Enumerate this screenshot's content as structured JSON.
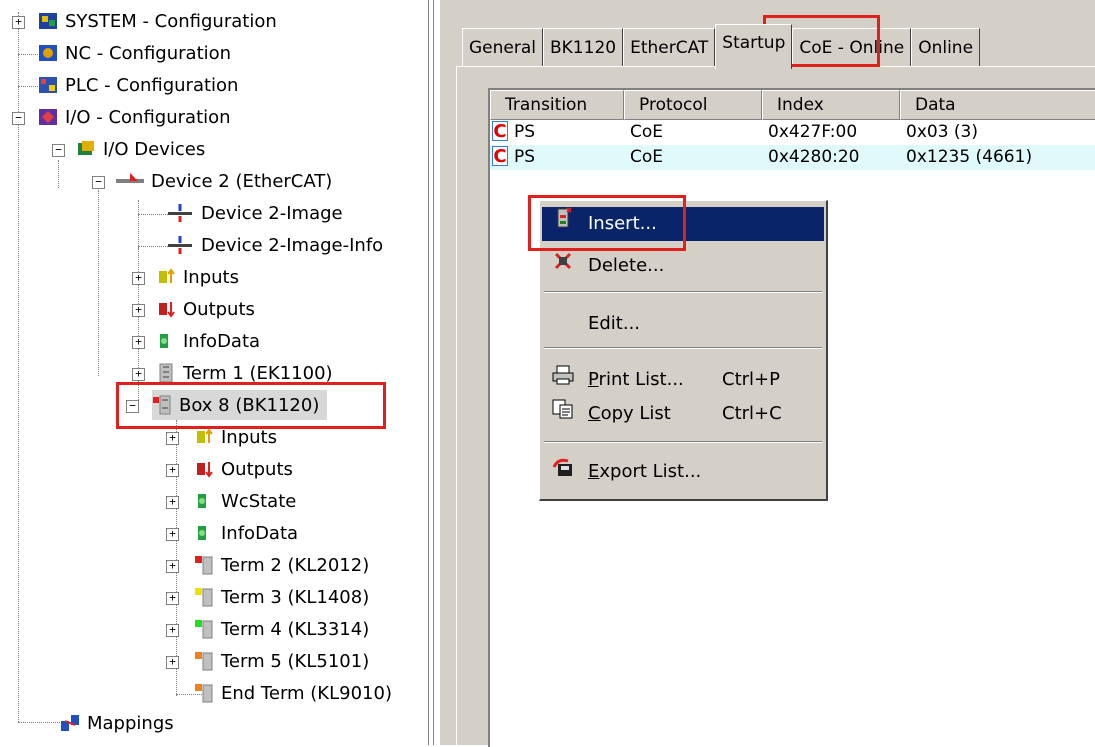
{
  "tree": {
    "system": "SYSTEM - Configuration",
    "nc": "NC - Configuration",
    "plc": "PLC - Configuration",
    "io": "I/O - Configuration",
    "io_devices": "I/O Devices",
    "device2": "Device 2 (EtherCAT)",
    "device2_image": "Device 2-Image",
    "device2_image_info": "Device 2-Image-Info",
    "inputs": "Inputs",
    "outputs": "Outputs",
    "infodata": "InfoData",
    "term1": "Term 1 (EK1100)",
    "box8": "Box 8 (BK1120)",
    "box_inputs": "Inputs",
    "box_outputs": "Outputs",
    "box_wcstate": "WcState",
    "box_infodata": "InfoData",
    "term2": "Term 2 (KL2012)",
    "term3": "Term 3 (KL1408)",
    "term4": "Term 4 (KL3314)",
    "term5": "Term 5 (KL5101)",
    "endterm": "End Term (KL9010)",
    "mappings": "Mappings",
    "expander_plus": "+",
    "expander_minus": "−"
  },
  "tabs": [
    "General",
    "BK1120",
    "EtherCAT",
    "Startup",
    "CoE - Online",
    "Online"
  ],
  "table": {
    "headers": [
      "Transition",
      "Protocol",
      "Index",
      "Data"
    ],
    "rows": [
      {
        "icon": "C",
        "transition": "PS",
        "protocol": "CoE",
        "index": "0x427F:00",
        "data": "0x03 (3)"
      },
      {
        "icon": "C",
        "transition": "PS",
        "protocol": "CoE",
        "index": "0x4280:20",
        "data": "0x1235 (4661)"
      }
    ]
  },
  "menu": {
    "insert": "Insert...",
    "delete": "Delete...",
    "edit": "Edit...",
    "print_list_pre": "",
    "print_list_u": "P",
    "print_list_post": "rint List...",
    "print_shortcut": "Ctrl+P",
    "copy_list_u": "C",
    "copy_list_post": "opy List",
    "copy_shortcut": "Ctrl+C",
    "export_list_u": "E",
    "export_list_post": "xport List..."
  },
  "colors": {
    "highlight_box": "#e0201c",
    "menu_highlight": "#0a246a",
    "window_bg": "#d4d0c8"
  }
}
